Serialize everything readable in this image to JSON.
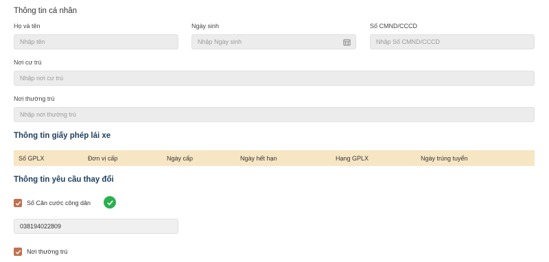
{
  "personal": {
    "title": "Thông tin cá nhân",
    "fullname": {
      "label": "Họ và tên",
      "placeholder": "Nhập tên"
    },
    "dob": {
      "label": "Ngày sinh",
      "placeholder": "Nhập Ngày sinh"
    },
    "idcard": {
      "label": "Số CMND/CCCD",
      "placeholder": "Nhập Số CMND/CCCD"
    },
    "residence": {
      "label": "Nơi cư trú",
      "placeholder": "Nhập nơi cư trú"
    },
    "permanent": {
      "label": "Nơi thường trú",
      "placeholder": "Nhập nơi thường trú"
    }
  },
  "license": {
    "title": "Thông tin giấy phép lái xe",
    "columns": [
      "Số GPLX",
      "Đơn vị cấp",
      "Ngày cấp",
      "Ngày hết hạn",
      "Hạng GPLX",
      "Ngày trúng tuyển"
    ]
  },
  "change": {
    "title": "Thông tin yêu cầu thay đổi",
    "citizen_id": {
      "label": "Số Căn cước công dân",
      "value": "038194022809",
      "checked": true
    },
    "permanent": {
      "label": "Nơi thường trú",
      "checked": true
    }
  },
  "colors": {
    "accent": "#c0714f",
    "table_header": "#f7e6c4",
    "success": "#2bb04f",
    "section_title": "#1d3d5f"
  },
  "icons": {
    "calendar": "calendar-icon",
    "check": "check-icon",
    "success": "check-circle-icon"
  }
}
